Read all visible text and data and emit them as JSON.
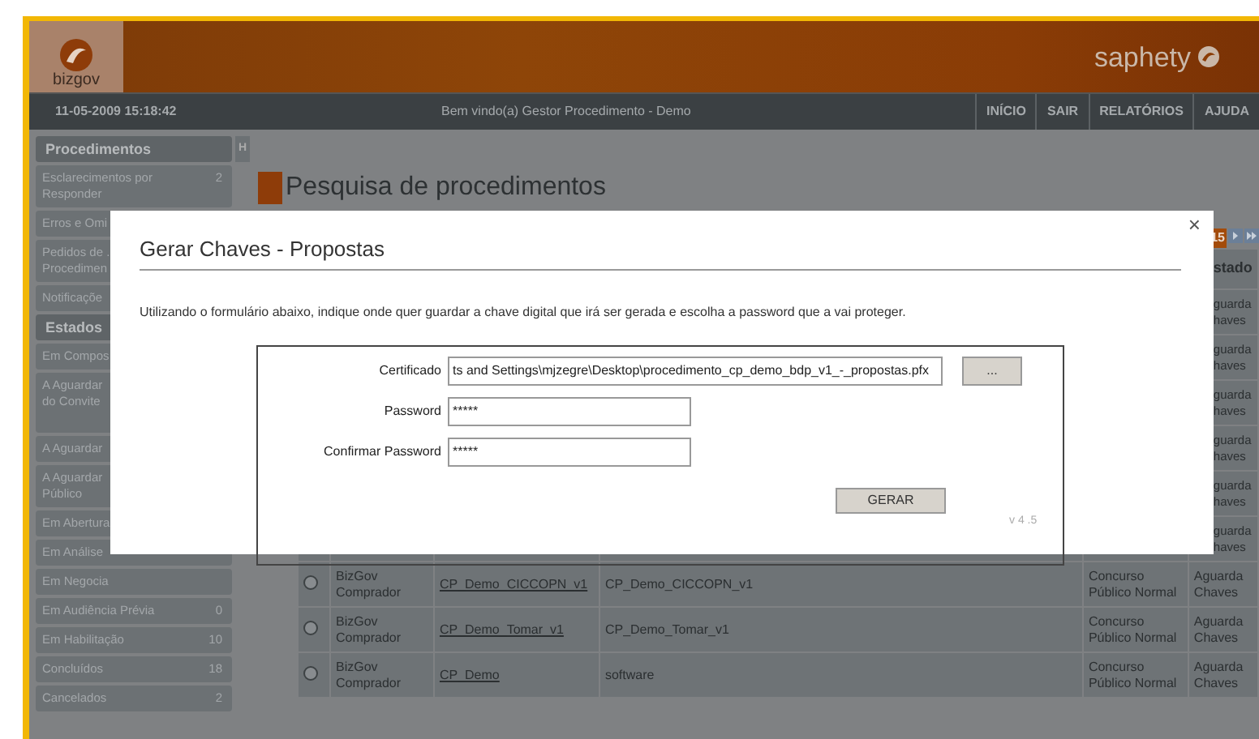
{
  "header": {
    "logo": "bizgov",
    "brand": "saphety"
  },
  "topbar": {
    "datetime": "11-05-2009 15:18:42",
    "welcome": "Bem vindo(a) Gestor Procedimento - Demo",
    "links": [
      "INÍCIO",
      "SAIR",
      "RELATÓRIOS",
      "AJUDA"
    ]
  },
  "sidebar": {
    "toggle": "H",
    "sections": [
      {
        "title": "Procedimentos",
        "items": [
          {
            "label": "Esclarecimentos por Responder",
            "count": "2"
          },
          {
            "label": "Erros e Omi"
          },
          {
            "label": "Pedidos de .\nProcedimen"
          },
          {
            "label": "Notificaçõe"
          }
        ]
      },
      {
        "title": "Estados",
        "items": [
          {
            "label": "Em Compos"
          },
          {
            "label": "A Aguardar\ndo Convite",
            "tall": true
          },
          {
            "label": "A Aguardar"
          },
          {
            "label": "A Aguardar\nPúblico"
          },
          {
            "label": "Em Abertura"
          },
          {
            "label": "Em Análise"
          },
          {
            "label": "Em Negocia"
          },
          {
            "label": "Em Audiência Prévia",
            "count": "0"
          },
          {
            "label": "Em Habilitação",
            "count": "10"
          },
          {
            "label": "Concluídos",
            "count": "18"
          },
          {
            "label": "Cancelados",
            "count": "2"
          }
        ]
      }
    ]
  },
  "page": {
    "title": "Pesquisa de procedimentos",
    "pager": {
      "current": "15"
    }
  },
  "table": {
    "status_heading": "stado",
    "rows": [
      {
        "kind": "covered",
        "status": "guarda haves"
      },
      {
        "kind": "covered",
        "status": "guarda haves"
      },
      {
        "kind": "covered",
        "status": "guarda haves"
      },
      {
        "kind": "covered",
        "status": "guarda haves"
      },
      {
        "kind": "covered",
        "status": "guarda haves"
      },
      {
        "kind": "covered",
        "status": "guarda haves"
      },
      {
        "kind": "full",
        "selected": false,
        "buyer": "BizGov Comprador",
        "code": "CP_Demo_CICCOPN_v1",
        "name": "CP_Demo_CICCOPN_v1",
        "type": "Concurso Público Normal",
        "status": "Aguarda Chaves"
      },
      {
        "kind": "full",
        "selected": false,
        "buyer": "BizGov Comprador",
        "code": "CP_Demo_Tomar_v1",
        "name": "CP_Demo_Tomar_v1",
        "type": "Concurso Público Normal",
        "status": "Aguarda Chaves"
      },
      {
        "kind": "full",
        "selected": false,
        "buyer": "BizGov Comprador",
        "code": "CP_Demo",
        "name": "software",
        "type": "Concurso Público Normal",
        "status": "Aguarda Chaves"
      }
    ]
  },
  "dialog": {
    "title": "Gerar Chaves - Propostas",
    "close": "×",
    "intro": "Utilizando o formulário abaixo, indique onde quer guardar a chave digital que irá ser gerada e escolha a password que a vai proteger.",
    "fields": [
      {
        "kind": "file",
        "label": "Certificado",
        "value": "ts and Settings\\mjzegre\\Desktop\\procedimento_cp_demo_bdp_v1_-_propostas.pfx",
        "browse": "..."
      },
      {
        "kind": "password",
        "label": "Password",
        "value": "*****"
      },
      {
        "kind": "password",
        "label": "Confirmar Password",
        "value": "*****"
      }
    ],
    "submit": "GERAR",
    "version": "v 4 .5"
  }
}
